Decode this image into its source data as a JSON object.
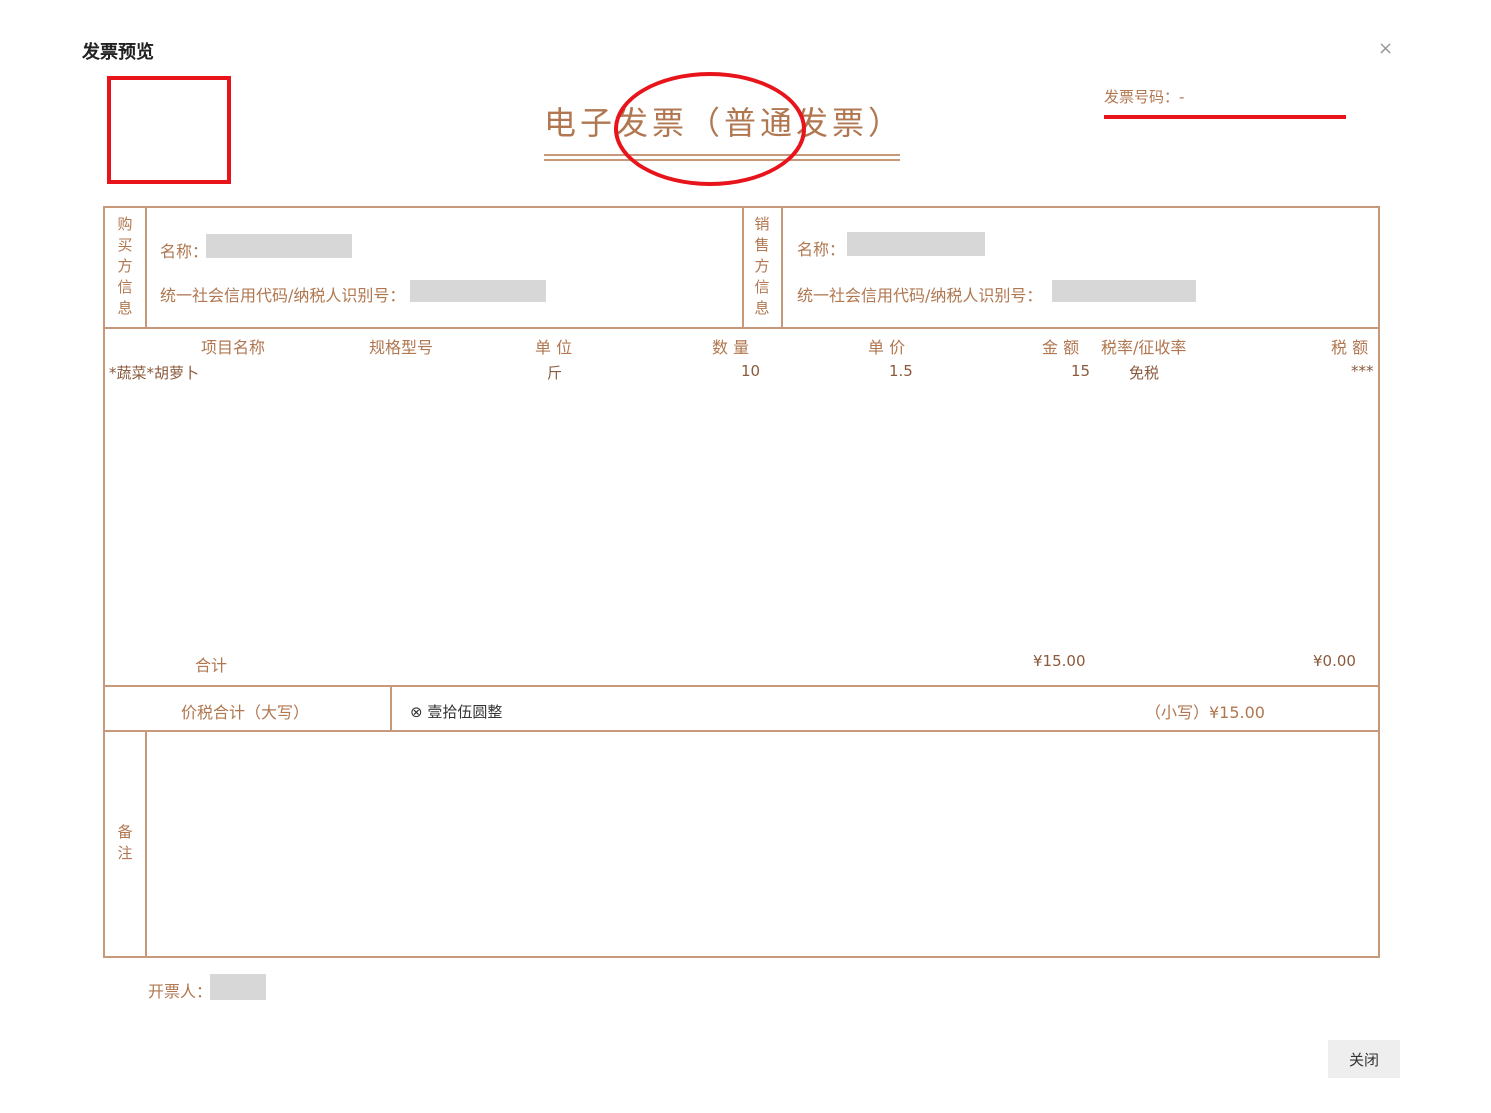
{
  "dialog": {
    "title": "发票预览",
    "close_glyph": "×",
    "close_button": "关闭"
  },
  "invoice": {
    "title": "电子发票（普通发票）",
    "number_label": "发票号码：",
    "number_value": "-",
    "buyer": {
      "section_label": "购买方信息",
      "name_label": "名称：",
      "tax_id_label": "统一社会信用代码/纳税人识别号："
    },
    "seller": {
      "section_label": "销售方信息",
      "name_label": "名称：",
      "tax_id_label": "统一社会信用代码/纳税人识别号："
    },
    "columns": [
      "项目名称",
      "规格型号",
      "单 位",
      "数 量",
      "单 价",
      "金 额",
      "税率/征收率",
      "税 额"
    ],
    "items": [
      {
        "name": "*蔬菜*胡萝卜",
        "spec": "",
        "unit": "斤",
        "qty": "10",
        "price": "1.5",
        "amount": "15",
        "rate": "免税",
        "tax": "***"
      }
    ],
    "total": {
      "label": "合计",
      "amount": "¥15.00",
      "tax": "¥0.00"
    },
    "grand_total": {
      "label": "价税合计（大写）",
      "uppercase": "⊗ 壹拾伍圆整",
      "lowercase": "（小写）¥15.00"
    },
    "remarks_label": "备注",
    "issuer_label": "开票人："
  },
  "colors": {
    "accent_red": "#e8141b",
    "border": "#c8987a",
    "text_brown": "#b07750"
  }
}
